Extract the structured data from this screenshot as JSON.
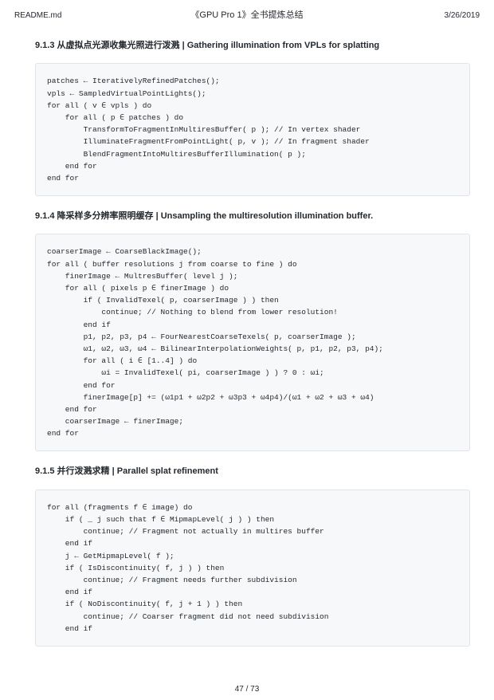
{
  "header": {
    "filename": "README.md",
    "title": "《GPU Pro 1》全书提炼总结",
    "date": "3/26/2019"
  },
  "sections": [
    {
      "number": "9.1.3",
      "title_cn": "从虚拟点光源收集光照进行泼溅",
      "title_en": "Gathering illumination from VPLs for splatting",
      "code": "patches ← IterativelyRefinedPatches();\nvpls ← SampledVirtualPointLights();\nfor all ( v ∈ vpls ) do\n    for all ( p ∈ patches ) do\n        TransformToFragmentInMultiresBuffer( p ); // In vertex shader\n        IlluminateFragmentFromPointLight( p, v ); // In fragment shader\n        BlendFragmentIntoMultiresBufferIllumination( p );\n    end for\nend for"
    },
    {
      "number": "9.1.4",
      "title_cn": "降采样多分辨率照明缓存",
      "title_en": "Unsampling the multiresolution illumination buffer.",
      "code": "coarserImage ← CoarseBlackImage();\nfor all ( buffer resolutions j from coarse to fine ) do\n    finerImage ← MultresBuffer( level j );\n    for all ( pixels p ∈ finerImage ) do\n        if ( InvalidTexel( p, coarserImage ) ) then\n            continue; // Nothing to blend from lower resolution!\n        end if\n        p1, p2, p3, p4 ← FourNearestCoarseTexels( p, coarserImage );\n        ω1, ω2, ω3, ω4 ← BilinearInterpolationWeights( p, p1, p2, p3, p4);\n        for all ( i ∈ [1..4] ) do\n            ωi = InvalidTexel( pi, coarserImage ) ) ? 0 : ωi;\n        end for\n        finerImage[p] += (ω1p1 + ω2p2 + ω3p3 + ω4p4)/(ω1 + ω2 + ω3 + ω4)\n    end for\n    coarserImage ← finerImage;\nend for"
    },
    {
      "number": "9.1.5",
      "title_cn": "并行泼溅求精",
      "title_en": "Parallel splat refinement",
      "code": "for all (fragments f ∈ image) do\n    if ( _ j such that f ∈ MipmapLevel( j ) ) then\n        continue; // Fragment not actually in multires buffer\n    end if\n    j ← GetMipmapLevel( f );\n    if ( IsDiscontinuity( f, j ) ) then\n        continue; // Fragment needs further subdivision\n    end if\n    if ( NoDiscontinuity( f, j + 1 ) ) then\n        continue; // Coarser fragment did not need subdivision\n    end if"
    }
  ],
  "footer": {
    "page": "47 / 73"
  }
}
